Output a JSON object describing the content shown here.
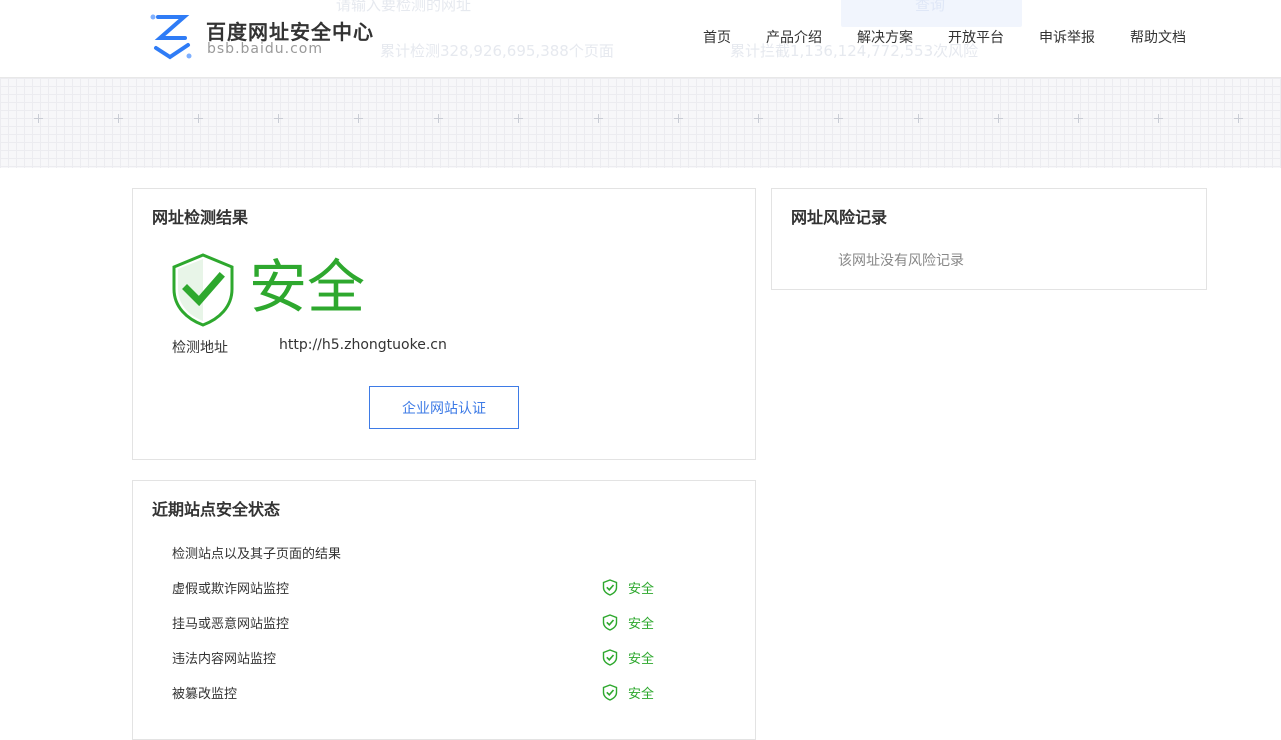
{
  "header": {
    "brand_title": "百度网址安全中心",
    "brand_sub": "bsb.baidu.com",
    "nav": [
      "首页",
      "产品介绍",
      "解决方案",
      "开放平台",
      "申诉举报",
      "帮助文档"
    ],
    "ghost": {
      "search_placeholder": "请输入要检测的网址",
      "query_button": "查询",
      "stat_pages": "累计检测328,926,695,388个页面",
      "stat_risks": "累计拦截1,136,124,772,553次风险"
    }
  },
  "result_panel": {
    "title": "网址检测结果",
    "verdict": "安全",
    "url_label": "检测地址",
    "url_value": "http://h5.zhongtuoke.cn",
    "cert_button": "企业网站认证"
  },
  "risk_panel": {
    "title": "网址风险记录",
    "empty_text": "该网址没有风险记录"
  },
  "status_panel": {
    "title": "近期站点安全状态",
    "subtitle": "检测站点以及其子页面的结果",
    "rows": [
      {
        "label": "虚假或欺诈网站监控",
        "status": "安全"
      },
      {
        "label": "挂马或恶意网站监控",
        "status": "安全"
      },
      {
        "label": "违法内容网站监控",
        "status": "安全"
      },
      {
        "label": "被篡改监控",
        "status": "安全"
      }
    ]
  },
  "colors": {
    "safe_green": "#2ea82e",
    "link_blue": "#3e7be6",
    "logo_blue": "#2f7cf6"
  },
  "icons": {
    "logo": "baidu-bsb-logo",
    "verdict": "shield-check-icon",
    "row": "shield-check-icon"
  }
}
